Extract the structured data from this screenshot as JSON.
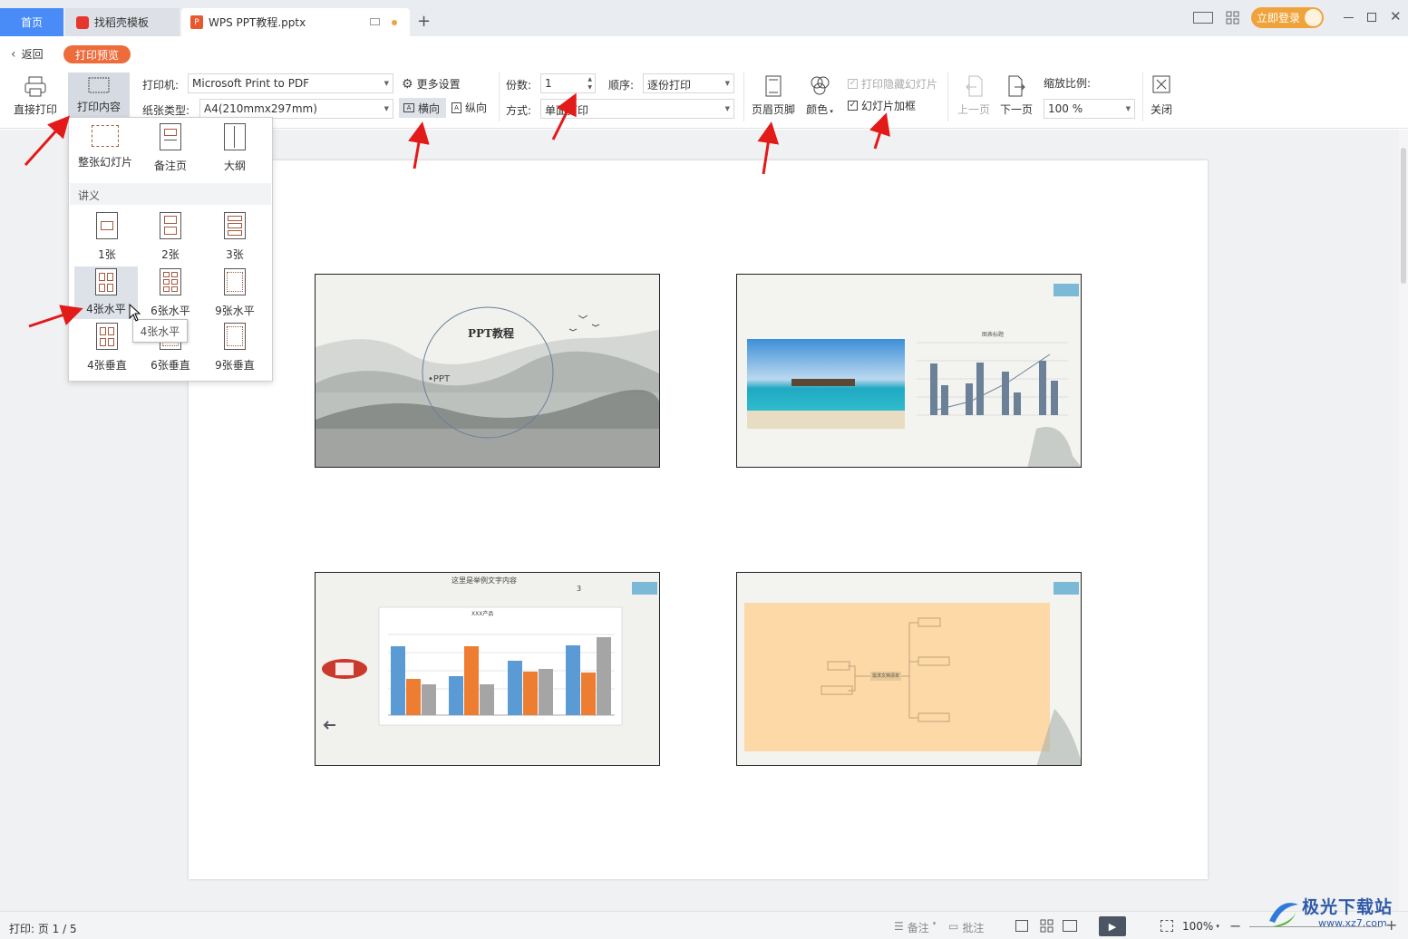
{
  "tabs": {
    "home": "首页",
    "template": "找稻壳模板",
    "doc": "WPS PPT教程.pptx",
    "login": "立即登录"
  },
  "header": {
    "back": "返回",
    "mode": "打印预览"
  },
  "ribbon": {
    "direct_print": "直接打印",
    "print_content": "打印内容",
    "printer_label": "打印机:",
    "printer_value": "Microsoft Print to PDF",
    "paper_label": "纸张类型:",
    "paper_value": "A4(210mmx297mm)",
    "more_settings": "更多设置",
    "landscape": "横向",
    "portrait": "纵向",
    "copies_label": "份数:",
    "copies_value": "1",
    "order_label": "顺序:",
    "order_value": "逐份打印",
    "mode_label": "方式:",
    "mode_value": "单面打印",
    "header_footer": "页眉页脚",
    "color": "颜色",
    "print_hidden": "打印隐藏幻灯片",
    "slide_frame": "幻灯片加框",
    "prev_page": "上一页",
    "next_page": "下一页",
    "zoom_label": "缩放比例:",
    "zoom_value": "100 %",
    "close": "关闭"
  },
  "dropdown": {
    "full_slide": "整张幻灯片",
    "notes_page": "备注页",
    "outline": "大纲",
    "handout_header": "讲义",
    "h1": "1张",
    "h2": "2张",
    "h3": "3张",
    "h4h": "4张水平",
    "h6h": "6张水平",
    "h9h": "9张水平",
    "h4v": "4张垂直",
    "h6v": "6张垂直",
    "h9v": "9张垂直",
    "tooltip": "4张水平"
  },
  "slides": {
    "s1_title": "PPT教程",
    "s1_bullet": "•PPT",
    "s2_chart_title": "图表标题",
    "s3_title": "这里是举例文字内容",
    "s3_num": "3",
    "s3_chart_title": "XXX产品",
    "s4_center": "需求文档清单"
  },
  "status": {
    "page_info": "打印: 页 1 / 5",
    "notes": "备注",
    "comments": "批注",
    "zoom": "100%"
  },
  "watermark": {
    "brand": "极光下载站",
    "url": "www.xz7.com"
  },
  "colors": {
    "accent_orange": "#ee6c3c",
    "tab_blue": "#4a8cf7",
    "annotation_red": "#e31a1a",
    "login_orange": "#f0a33b"
  }
}
